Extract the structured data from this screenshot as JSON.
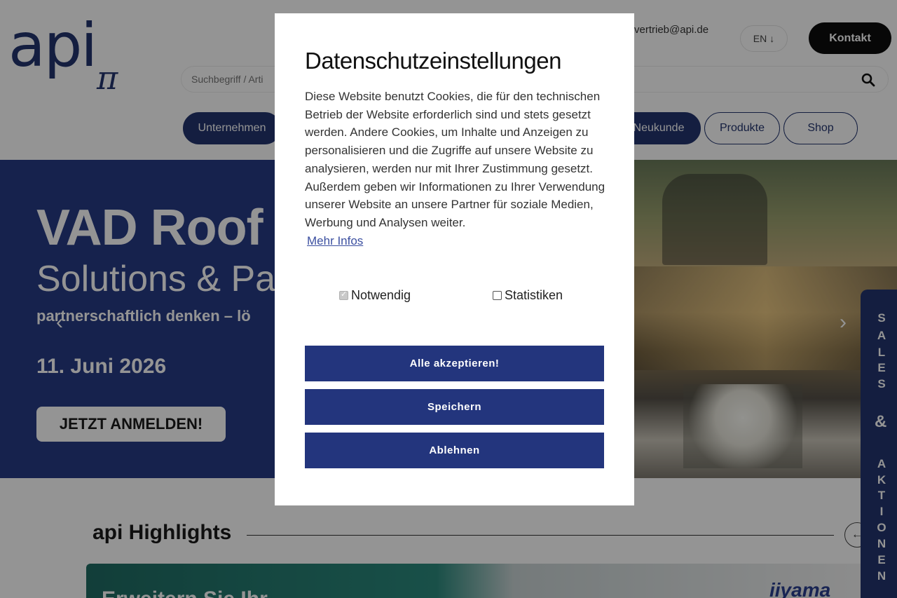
{
  "header": {
    "logo_text": "api",
    "logo_sub": "π",
    "email": "vertrieb@api.de",
    "lang": "EN",
    "lang_arrow": "↓",
    "contact": "Kontakt",
    "search_placeholder": "Suchbegriff / Artikelnummer",
    "search_visible": "Suchbegriff / Arti",
    "nav": [
      {
        "label": "Unternehmen"
      },
      {
        "label": "Neukunde"
      },
      {
        "label": "Produkte"
      },
      {
        "label": "Shop"
      }
    ]
  },
  "hero": {
    "title": "VAD Roof",
    "subtitle": "Solutions & Pa",
    "tagline": "partnerschaftlich denken – lö",
    "date": "11. Juni 2026",
    "cta": "JETZT ANMELDEN!",
    "arrow_left": "‹",
    "arrow_right": "›"
  },
  "highlights": {
    "title": "api Highlights",
    "prev": "←",
    "card_text": "Erweitern Sie Ihr",
    "card_brand": "iiyama"
  },
  "sales_tab": {
    "line1": [
      "S",
      "A",
      "L",
      "E",
      "S"
    ],
    "amp": "&",
    "line2": [
      "A",
      "K",
      "T",
      "I",
      "O",
      "N",
      "E",
      "N"
    ]
  },
  "modal": {
    "title": "Datenschutzeinstellungen",
    "body": "Diese Website benutzt Cookies, die für den technischen Betrieb der Website erforderlich sind und stets gesetzt werden. Andere Cookies, um Inhalte und Anzeigen zu personalisieren und die Zugriffe auf unsere Website zu analysieren, werden nur mit Ihrer Zustimmung gesetzt. Außerdem geben wir Informationen zu Ihrer Verwendung unserer Website an unsere Partner für soziale Medien, Werbung und Analysen weiter.",
    "more_info": "Mehr Infos",
    "options": [
      {
        "label": "Notwendig",
        "checked": true,
        "disabled": true
      },
      {
        "label": "Statistiken",
        "checked": false,
        "disabled": false
      }
    ],
    "accept_all": "Alle akzeptieren!",
    "save": "Speichern",
    "decline": "Ablehnen"
  },
  "colors": {
    "brand_navy": "#23356e",
    "hero_blue": "#273b86",
    "button_blue": "#23357d",
    "overlay": "rgba(0,0,0,0.42)"
  }
}
